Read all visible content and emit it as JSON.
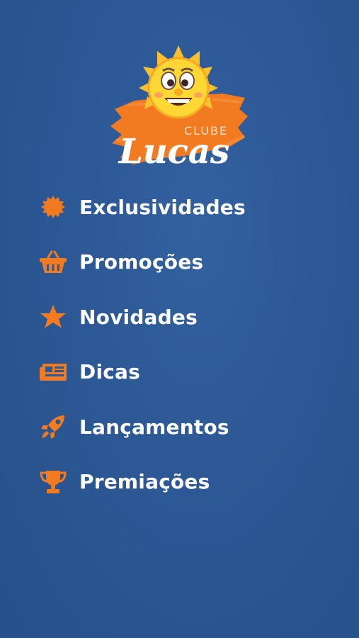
{
  "brand": {
    "clube_text": "CLUBE",
    "lucas_text": "Lucas",
    "logo_icon": "sun-mascot-icon",
    "colors": {
      "background": "#2c5895",
      "accent_orange": "#f27b21",
      "sun_yellow": "#fbc02d",
      "text": "#ffffff"
    }
  },
  "menu": {
    "items": [
      {
        "label": "Exclusividades",
        "icon": "badge-icon"
      },
      {
        "label": "Promoções",
        "icon": "basket-icon"
      },
      {
        "label": "Novidades",
        "icon": "star-icon"
      },
      {
        "label": "Dicas",
        "icon": "newspaper-icon"
      },
      {
        "label": "Lançamentos",
        "icon": "rocket-icon"
      },
      {
        "label": "Premiações",
        "icon": "trophy-icon"
      }
    ]
  }
}
